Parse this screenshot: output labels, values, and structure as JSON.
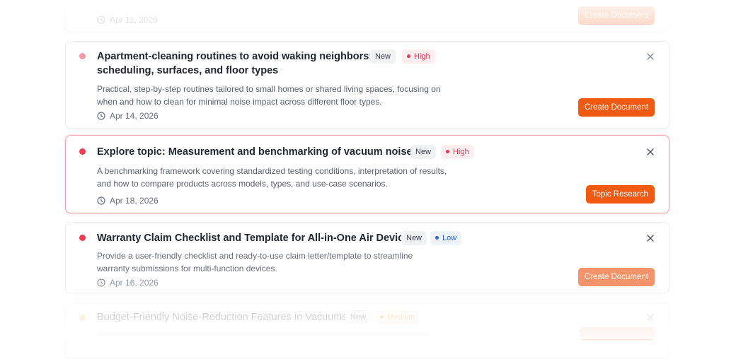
{
  "cards": [
    {
      "title": "",
      "description": "",
      "date": "Apr 11, 2026",
      "button": "Create Document"
    },
    {
      "title_line1": "Apartment-cleaning routines to avoid waking neighbors:",
      "title_line2": "scheduling, surfaces, and floor types",
      "badge_new": "New",
      "badge_priority": "High",
      "description_line1": "Practical, step-by-step routines tailored to small homes or shared living spaces, focusing on",
      "description_line2": "when and how to clean for minimal noise impact across different floor types.",
      "date": "Apr 14, 2026",
      "button": "Create Document"
    },
    {
      "title": "Explore topic: Measurement and benchmarking of vacuum noise",
      "badge_new": "New",
      "badge_priority": "High",
      "description_line1": "A benchmarking framework covering standardized testing conditions, interpretation of results,",
      "description_line2": "and how to compare products across models, types, and use-case scenarios.",
      "date": "Apr 18, 2026",
      "button": "Topic Research"
    },
    {
      "title": "Warranty Claim Checklist and Template for All-in-One Air Devices",
      "badge_new": "New",
      "badge_priority": "Low",
      "description_line1": "Provide a user-friendly checklist and ready-to-use claim letter/template to streamline",
      "description_line2": "warranty submissions for multi-function devices.",
      "date": "Apr 16, 2026",
      "button": "Create Document"
    },
    {
      "title": "Budget-Friendly Noise-Reduction Features in Vacuums",
      "badge_new": "New",
      "badge_priority": "Medium"
    }
  ],
  "colors": {
    "accent": "#f25a12",
    "priority_high": "#e23a52",
    "priority_low": "#2f63d8",
    "priority_medium": "#e89a2c",
    "dot_high": "#ee3d52",
    "dot_medium": "#f2b45c"
  },
  "icons": {
    "status": "status-dot-icon",
    "date": "clock-icon",
    "dismiss": "close-icon"
  }
}
